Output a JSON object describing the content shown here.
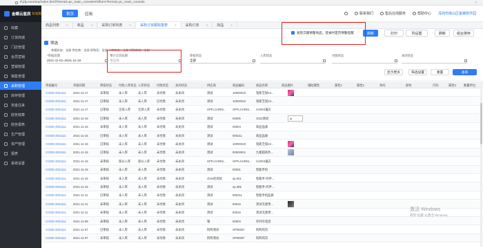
{
  "browser": {
    "url": "tf.jdy.com/erp/index.html?formId=pc_main_console#/dform?formId=pc_main_console"
  },
  "header": {
    "logo_text": "金蝶云星辰",
    "logo_sub": "标准版",
    "nav": [
      {
        "label": "首页"
      },
      {
        "label": "应用"
      }
    ],
    "right": [
      {
        "label": "联系我们"
      },
      {
        "label": "售后在线服务"
      },
      {
        "label": "帮助中心"
      }
    ],
    "company": "深圳市南山区金蝶软件园"
  },
  "sidebar": {
    "items": [
      {
        "label": "收藏"
      },
      {
        "label": "订货商城"
      },
      {
        "label": "门店管理"
      },
      {
        "label": "会员营销"
      },
      {
        "label": "营销管理"
      },
      {
        "label": "销售管理"
      },
      {
        "label": "采购管理"
      },
      {
        "label": "库存管理"
      },
      {
        "label": "资金往来"
      },
      {
        "label": "财务核算"
      },
      {
        "label": "财务报表"
      },
      {
        "label": "生产管理"
      },
      {
        "label": "资产管理"
      },
      {
        "label": "报表"
      },
      {
        "label": "系统设置"
      }
    ]
  },
  "tabs": [
    {
      "label": "商品列表"
    },
    {
      "label": "商品"
    },
    {
      "label": "采购订单列表"
    },
    {
      "label": "采购订单跟踪报表"
    },
    {
      "label": "采购订单"
    },
    {
      "label": "商品"
    }
  ],
  "toolbar": {
    "checkbox_text": "发现交期预警商品，登录时首页预警提醒",
    "buttons": [
      {
        "label": "刷新"
      },
      {
        "label": "打印"
      },
      {
        "label": "列设置"
      },
      {
        "label": "刷新"
      },
      {
        "label": "组合排序"
      }
    ]
  },
  "filter": {
    "title": "筛选",
    "crumbs": "单据状态：全部  供应商：全部  采购员：全部  入库状态：全部  付款状态：全部",
    "fields": [
      {
        "label": "*单据日期",
        "value": "2021-11-01~2021-11-19"
      },
      {
        "label": "预计交货日期",
        "value": "请选择"
      },
      {
        "label": "审核状态",
        "value": "全部"
      },
      {
        "label": "入库状态",
        "value": ""
      },
      {
        "label": "付款状态",
        "value": ""
      },
      {
        "label": "关闭状态",
        "value": ""
      }
    ],
    "buttons": [
      {
        "label": "显示更多"
      },
      {
        "label": "筛选设置"
      },
      {
        "label": "重置"
      },
      {
        "label": "查询"
      }
    ]
  },
  "table": {
    "headers": [
      "单据编号",
      "单据日期",
      "审核状态",
      "付款入库状态",
      "入库状态",
      "付款状态",
      "关闭状态",
      "供应商",
      "商品编码",
      "商品名称",
      "商品图片",
      "辅助属性",
      "属性1",
      "属性2",
      "条码",
      "颜色",
      "尺码",
      "属性3",
      "数量单位"
    ],
    "rows": [
      {
        "no": "CGDD-2021111",
        "date": "2021-11-17",
        "audit": "未审核",
        "instock": "未入库",
        "pay": "未付款",
        "close": "未关闭",
        "supplier": "测试",
        "code": "10000023",
        "name": "铭斯芝保22...",
        "img": "thumb1"
      },
      {
        "no": "CGDD-2021111",
        "date": "2021-11-17",
        "audit": "已审核",
        "instock": "未入库",
        "pay": "已付款",
        "close": "未关闭",
        "supplier": "测试",
        "code": "10000023",
        "name": "铭斯芝保22...",
        "img": ""
      },
      {
        "no": "CGDD-2021111",
        "date": "2021-11-17",
        "audit": "已审核",
        "instock": "全部入库",
        "pay": "未付款",
        "close": "未关闭",
        "supplier": "SPFLCHRIS...",
        "code": "SPFLCHRIS...",
        "name": "CHRIS偏方",
        "img": ""
      },
      {
        "no": "CGDD-2021111",
        "date": "2021-11-16",
        "audit": "已审核",
        "instock": "未入库",
        "pay": "未付款",
        "close": "未关闭",
        "supplier": "测试",
        "code": "00005",
        "name": "1022测试",
        "img": "broken"
      },
      {
        "no": "CGDD-2021111",
        "date": "2021-11-16",
        "audit": "未审核",
        "instock": "未入库",
        "pay": "未付款",
        "close": "未关闭",
        "supplier": "测试",
        "code": "00004",
        "name": "商品品质",
        "img": ""
      },
      {
        "no": "CGDD-2021111",
        "date": "2021-11-16",
        "audit": "已审核",
        "instock": "未入库",
        "pay": "未付款",
        "close": "未关闭",
        "supplier": "测试",
        "code": "000211",
        "name": "商品品质",
        "img": ""
      },
      {
        "no": "CGDD-2021111",
        "date": "2021-11-16",
        "audit": "已审核",
        "instock": "未入库",
        "pay": "未付款",
        "close": "未关闭",
        "supplier": "测试",
        "code": "10000023",
        "name": "铭斯芝保22...",
        "img": "thumb1"
      },
      {
        "no": "CGDD-2021111",
        "date": "2021-11-15",
        "audit": "已审核",
        "instock": "未入库",
        "pay": "未付款",
        "close": "未关闭",
        "supplier": "测试",
        "code": "00000501",
        "name": "九尾狐商务...",
        "img": "thumb2"
      },
      {
        "no": "CGDD-2021111",
        "date": "2021-11-15",
        "audit": "未审核",
        "instock": "部分入库",
        "pay": "未付款",
        "close": "未关闭",
        "supplier": "SPFLCHRIS...",
        "code": "SPFLCHRIS...",
        "name": "CHRIS偏方",
        "img": ""
      },
      {
        "no": "CGDD-2021111",
        "date": "2021-11-15",
        "audit": "未审核",
        "instock": "未入库",
        "pay": "未付款",
        "close": "未关闭",
        "supplier": "测试",
        "code": "00001",
        "name": "智能手机",
        "img": ""
      },
      {
        "no": "CGDD-2021111",
        "date": "2021-11-15",
        "audit": "未审核",
        "instock": "未入库",
        "pay": "未付款",
        "close": "未关闭",
        "supplier": "chris的测试",
        "code": "sp.001",
        "name": "智能手-的手...",
        "img": ""
      },
      {
        "no": "CGDD-2021111",
        "date": "2021-11-15",
        "audit": "未审核",
        "instock": "未入库",
        "pay": "未付款",
        "close": "未关闭",
        "supplier": "测试",
        "code": "sp.385",
        "name": "智能手-的手...",
        "img": ""
      },
      {
        "no": "CGDD-2021111",
        "date": "2021-11-11",
        "audit": "已审核",
        "instock": "未入库",
        "pay": "未付款",
        "close": "未关闭",
        "supplier": "测试",
        "code": "000211",
        "name": "智能手机品质",
        "img": ""
      },
      {
        "no": "CGDD-2021111",
        "date": "2021-11-11",
        "audit": "未审核",
        "instock": "未入库",
        "pay": "未付款",
        "close": "未关闭",
        "supplier": "测试",
        "code": "00016",
        "name": "测试无使用...",
        "img": "thumb3"
      },
      {
        "no": "CGDD-2021111",
        "date": "2021-11-11",
        "audit": "未审核",
        "instock": "未入库",
        "pay": "未付款",
        "close": "未关闭",
        "supplier": "测试",
        "code": "00016",
        "name": "测试无使用...",
        "img": ""
      },
      {
        "no": "CGDD-2021111",
        "date": "2021-11-08",
        "audit": "未审核",
        "instock": "未入库",
        "pay": "未付款",
        "close": "未关闭",
        "supplier": "锦",
        "code": "00003",
        "name": "序列号电话",
        "img": ""
      },
      {
        "no": "CGDD-2021111",
        "date": "2021-11-07",
        "audit": "已审核",
        "instock": "未入库",
        "pay": "未付款",
        "close": "未关闭",
        "supplier": "阿辉测试",
        "code": "SP00057",
        "name": "阿辉的货",
        "img": ""
      },
      {
        "no": "CGDD-2021111",
        "date": "2021-11-07",
        "audit": "未审核",
        "instock": "未入库",
        "pay": "未付款",
        "close": "未关闭",
        "supplier": "阿辉测试",
        "code": "SP00057",
        "name": "阿辉的货",
        "img": ""
      }
    ]
  },
  "watermark": {
    "line1": "激活 Windows",
    "line2": "转到\"设置\"以激活 Windows。"
  },
  "colors": {
    "accent": "#2e7cf6",
    "sidebar": "#2a2d33",
    "highlight": "#e02020"
  }
}
